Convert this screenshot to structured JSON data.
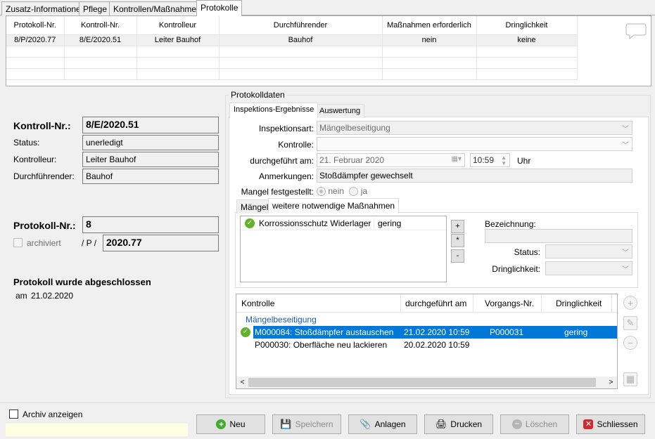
{
  "tabs": [
    "Zusatz-Informationen",
    "Pflege",
    "Kontrollen/Maßnahmen",
    "Protokolle"
  ],
  "top_grid": {
    "headers": [
      "Protokoll-Nr.",
      "Kontroll-Nr.",
      "Kontrolleur",
      "Durchführender",
      "Maßnahmen erforderlich",
      "Dringlichkeit"
    ],
    "rows": [
      [
        "8/P/2020.77",
        "8/E/2020.51",
        "Leiter Bauhof",
        "Bauhof",
        "nein",
        "keine"
      ]
    ]
  },
  "left": {
    "kontroll_label": "Kontroll-Nr.:",
    "kontroll_value": "8/E/2020.51",
    "status_label": "Status:",
    "status_value": "unerledigt",
    "kontrolleur_label": "Kontrolleur:",
    "kontrolleur_value": "Leiter Bauhof",
    "durch_label": "Durchführender:",
    "durch_value": "Bauhof",
    "protokoll_label": "Protokoll-Nr.:",
    "protokoll_value": "8",
    "archiviert_label": "archiviert",
    "p_sep": "/ P /",
    "protokoll_year": "2020.77",
    "abgeschlossen": "Protokoll wurde abgeschlossen",
    "am_label": "am",
    "am_date": "21.02.2020"
  },
  "protokolldaten": {
    "group_title": "Protokolldaten",
    "tabs": [
      "Inspektions-Ergebnisse",
      "Auswertung"
    ],
    "inspektionsart_label": "Inspektionsart:",
    "inspektionsart_value": "Mängelbeseitigung",
    "kontrolle_label": "Kontrolle:",
    "kontrolle_value": "",
    "durchgefuehrt_label": "durchgeführt am:",
    "durchgefuehrt_date": "21.  Februar   2020",
    "time_value": "10:59",
    "uhr_label": "Uhr",
    "anmerkungen_label": "Anmerkungen:",
    "anmerkungen_value": "Stoßdämpfer gewechselt",
    "mangel_label": "Mangel festgestellt:",
    "nein_label": "nein",
    "ja_label": "ja",
    "subtabs": [
      "Mängel",
      "weitere notwendige Maßnahmen"
    ],
    "massnahmen": [
      {
        "name": "Korrossionsschutz Widerlager",
        "level": "gering"
      }
    ],
    "bezeichnung_label": "Bezeichnung:",
    "status_label": "Status:",
    "dringlichkeit_label": "Dringlichkeit:"
  },
  "lower_grid": {
    "headers": [
      "Kontrolle",
      "durchgeführt am",
      "Vorgangs-Nr.",
      "Dringlichkeit"
    ],
    "group": "Mängelbeseitigung",
    "rows": [
      {
        "kontrolle": "M000084: Stoßdämpfer austauschen",
        "datum": "21.02.2020 10:59",
        "vorgang": "P000031",
        "dringlichkeit": "gering"
      },
      {
        "kontrolle": "P000030: Oberfläche neu lackieren",
        "datum": "20.02.2020 10:59",
        "vorgang": "",
        "dringlichkeit": ""
      }
    ]
  },
  "footer": {
    "archiv_label": "Archiv anzeigen",
    "buttons": [
      "Neu",
      "Speichern",
      "Anlagen",
      "Drucken",
      "Löschen",
      "Schliessen"
    ]
  },
  "colors": {
    "selection": "#0078d7",
    "group_header": "#1c5bbd",
    "ok_green": "#61b32c",
    "close_red": "#d42a2a",
    "add_green": "#3fae2a"
  }
}
